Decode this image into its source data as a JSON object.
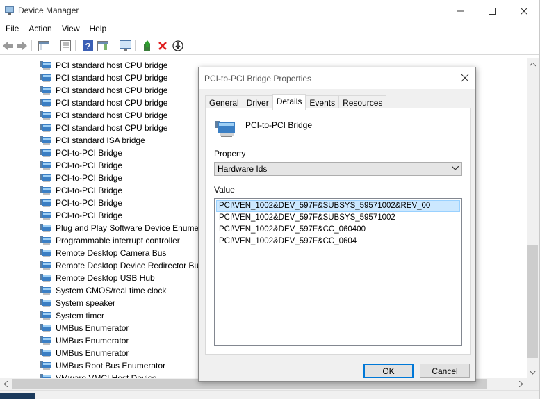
{
  "window": {
    "title": "Device Manager",
    "controls": [
      "minimize-icon",
      "maximize-icon",
      "close-icon"
    ]
  },
  "menu": [
    "File",
    "Action",
    "View",
    "Help"
  ],
  "toolbar": [
    "back-icon",
    "forward-icon",
    "show-hide-console-tree-icon",
    "properties-icon",
    "help-icon",
    "action-pane-icon",
    "scan-hardware-icon",
    "update-driver-icon",
    "uninstall-icon",
    "disable-device-icon"
  ],
  "tree": {
    "items": [
      "PCI standard host CPU bridge",
      "PCI standard host CPU bridge",
      "PCI standard host CPU bridge",
      "PCI standard host CPU bridge",
      "PCI standard host CPU bridge",
      "PCI standard host CPU bridge",
      "PCI standard ISA bridge",
      "PCI-to-PCI Bridge",
      "PCI-to-PCI Bridge",
      "PCI-to-PCI Bridge",
      "PCI-to-PCI Bridge",
      "PCI-to-PCI Bridge",
      "PCI-to-PCI Bridge",
      "Plug and Play Software Device Enumera",
      "Programmable interrupt controller",
      "Remote Desktop Camera Bus",
      "Remote Desktop Device Redirector Bus",
      "Remote Desktop USB Hub",
      "System CMOS/real time clock",
      "System speaker",
      "System timer",
      "UMBus Enumerator",
      "UMBus Enumerator",
      "UMBus Enumerator",
      "UMBus Root Bus Enumerator",
      "VMware VMCI Host Device"
    ]
  },
  "dialog": {
    "title": "PCI-to-PCI Bridge Properties",
    "tabs": [
      "General",
      "Driver",
      "Details",
      "Events",
      "Resources"
    ],
    "active_tab": "Details",
    "device_name": "PCI-to-PCI Bridge",
    "property_label": "Property",
    "property_value": "Hardware Ids",
    "value_label": "Value",
    "values": [
      "PCI\\VEN_1002&DEV_597F&SUBSYS_59571002&REV_00",
      "PCI\\VEN_1002&DEV_597F&SUBSYS_59571002",
      "PCI\\VEN_1002&DEV_597F&CC_060400",
      "PCI\\VEN_1002&DEV_597F&CC_0604"
    ],
    "ok_label": "OK",
    "cancel_label": "Cancel"
  },
  "colors": {
    "selection": "#cce8ff",
    "accent": "#0078d7"
  }
}
